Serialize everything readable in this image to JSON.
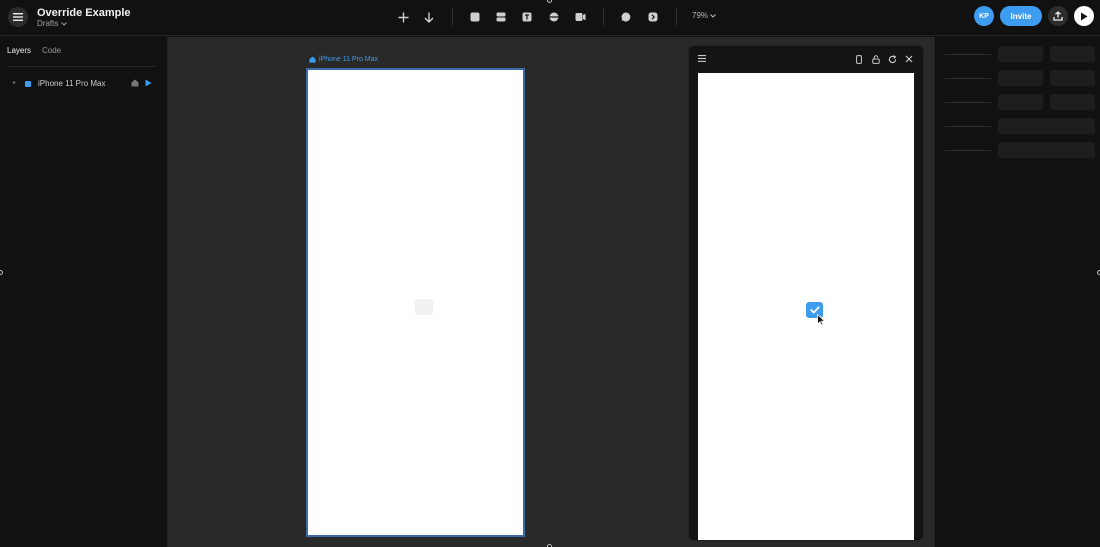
{
  "header": {
    "title": "Override Example",
    "subtitle": "Drafts",
    "zoom": "79%",
    "avatar_initials": "KP",
    "invite_label": "Invite"
  },
  "left_panel": {
    "tabs": [
      {
        "label": "Layers",
        "active": true
      },
      {
        "label": "Code",
        "active": false
      }
    ],
    "layers": [
      {
        "name": "iPhone 11 Pro Max",
        "icon": "frame-icon"
      }
    ]
  },
  "canvas": {
    "frame_label": "iPhone 11 Pro Max"
  },
  "preview": {
    "checkbox_checked": true
  },
  "colors": {
    "accent": "#3e9cf0",
    "background": "#111111",
    "canvas": "#292929",
    "frame_border": "#3d6aa6"
  },
  "icons": {
    "toolbar": [
      "plus-icon",
      "arrow-down-icon",
      "frame-tool-icon",
      "stack-tool-icon",
      "text-tool-icon",
      "component-tool-icon",
      "video-tool-icon",
      "comment-icon",
      "forward-icon"
    ],
    "preview": [
      "hamburger-icon",
      "device-icon",
      "lock-icon",
      "refresh-icon",
      "close-icon"
    ]
  }
}
